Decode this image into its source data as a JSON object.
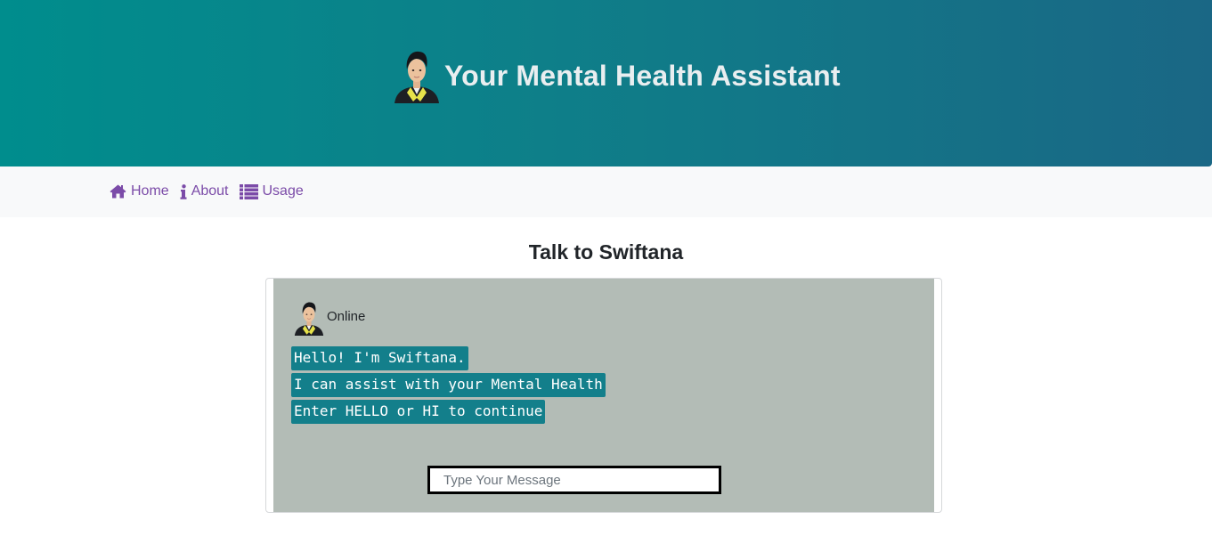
{
  "header": {
    "title": "Your Mental Health Assistant",
    "avatar_icon": "assistant-avatar-icon"
  },
  "nav": {
    "items": [
      {
        "label": "Home",
        "icon": "home-icon"
      },
      {
        "label": "About",
        "icon": "info-icon"
      },
      {
        "label": "Usage",
        "icon": "list-icon"
      }
    ]
  },
  "main": {
    "title": "Talk to Swiftana"
  },
  "chat": {
    "status": "Online",
    "messages": [
      "Hello! I'm Swiftana.",
      "I can assist with your Mental Health",
      "Enter HELLO or HI to continue"
    ],
    "input_placeholder": "Type Your Message",
    "input_value": ""
  },
  "colors": {
    "header_gradient_start": "#008d8d",
    "header_gradient_end": "#1a6785",
    "nav_link": "#7b4ba8",
    "bubble_bg": "#137f8b",
    "chat_bg": "#b3bcb6"
  }
}
